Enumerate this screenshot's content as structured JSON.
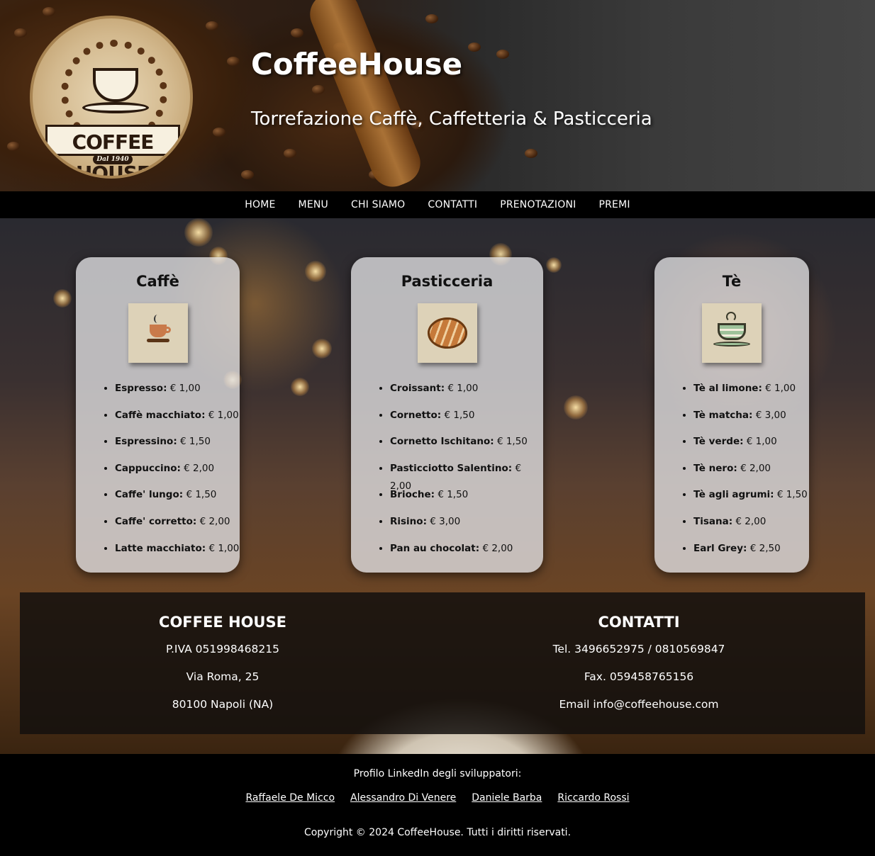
{
  "header": {
    "title": "CoffeeHouse",
    "subtitle": "Torrefazione Caffè, Caffetteria & Pasticceria",
    "logo_text": "COFFEE HOUSE",
    "logo_subtext": "Dal 1940"
  },
  "nav": {
    "items": [
      {
        "label": "HOME"
      },
      {
        "label": "MENU"
      },
      {
        "label": "CHI SIAMO"
      },
      {
        "label": "CONTATTI"
      },
      {
        "label": "PRENOTAZIONI"
      },
      {
        "label": "PREMI"
      }
    ]
  },
  "menu": {
    "cards": [
      {
        "title": "Caffè",
        "icon": "coffee-cup-icon",
        "items": [
          {
            "name": "Espresso:",
            "price": "€ 1,00"
          },
          {
            "name": "Caffè macchiato:",
            "price": "€ 1,00"
          },
          {
            "name": "Espressino:",
            "price": "€ 1,50"
          },
          {
            "name": "Cappuccino:",
            "price": "€ 2,00"
          },
          {
            "name": "Caffe' lungo:",
            "price": "€ 1,50"
          },
          {
            "name": "Caffe' corretto:",
            "price": "€ 2,00"
          },
          {
            "name": "Latte macchiato:",
            "price": "€ 1,00"
          }
        ]
      },
      {
        "title": "Pasticceria",
        "icon": "croissant-icon",
        "items": [
          {
            "name": "Croissant:",
            "price": "€ 1,00"
          },
          {
            "name": "Cornetto:",
            "price": "€ 1,50"
          },
          {
            "name": "Cornetto Ischitano:",
            "price": "€ 1,50"
          },
          {
            "name": "Pasticciotto Salentino:",
            "price": "€ 2,00"
          },
          {
            "name": "Brioche:",
            "price": "€ 1,50"
          },
          {
            "name": "Risino:",
            "price": "€ 3,00"
          },
          {
            "name": "Pan au chocolat:",
            "price": "€ 2,00"
          }
        ]
      },
      {
        "title": "Tè",
        "icon": "tea-cup-icon",
        "items": [
          {
            "name": "Tè al limone:",
            "price": "€ 1,00"
          },
          {
            "name": "Tè matcha:",
            "price": "€ 3,00"
          },
          {
            "name": "Tè verde:",
            "price": "€ 1,00"
          },
          {
            "name": "Tè nero:",
            "price": "€ 2,00"
          },
          {
            "name": "Tè agli agrumi:",
            "price": "€ 1,50"
          },
          {
            "name": "Tisana:",
            "price": "€ 2,00"
          },
          {
            "name": "Earl Grey:",
            "price": "€ 2,50"
          }
        ]
      }
    ]
  },
  "info": {
    "company": {
      "title": "COFFEE HOUSE",
      "lines": [
        "P.IVA 051998468215",
        "Via Roma, 25",
        "80100 Napoli (NA)"
      ]
    },
    "contacts": {
      "title": "CONTATTI",
      "lines": [
        "Tel. 3496652975 / 0810569847",
        "Fax. 059458765156",
        "Email info@coffeehouse.com"
      ]
    }
  },
  "footer": {
    "label": "Profilo LinkedIn degli sviluppatori:",
    "developers": [
      "Raffaele De Micco",
      "Alessandro Di Venere",
      "Daniele Barba",
      "Riccardo Rossi"
    ],
    "copyright": "Copyright © 2024 CoffeeHouse. Tutti i diritti riservati."
  }
}
